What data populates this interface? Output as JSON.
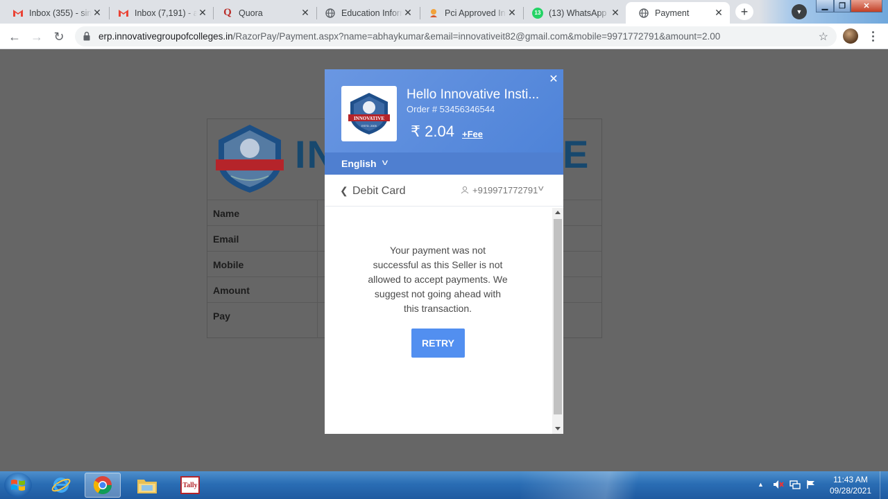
{
  "tabs": [
    {
      "label": "Inbox (355) - sin",
      "icon": "gmail-icon"
    },
    {
      "label": "Inbox (7,191) - a",
      "icon": "gmail-icon"
    },
    {
      "label": "Quora",
      "icon": "quora-icon"
    },
    {
      "label": "Education Inform",
      "icon": "globe-icon"
    },
    {
      "label": "Pci Approved In",
      "icon": "pci-icon"
    },
    {
      "label": "(13) WhatsApp",
      "icon": "whatsapp-icon",
      "badge": "13"
    },
    {
      "label": "Payment",
      "icon": "globe-icon",
      "active": true
    }
  ],
  "address": {
    "host": "erp.innovativegroupofcolleges.in",
    "path": "/RazorPay/Payment.aspx?name=abhaykumar&email=innovativeit82@gmail.com&mobile=9971772791&amount=2.00"
  },
  "page": {
    "brand_text": "IN",
    "brand_text_right": "E",
    "rows": [
      {
        "label": "Name"
      },
      {
        "label": "Email"
      },
      {
        "label": "Mobile"
      },
      {
        "label": "Amount"
      },
      {
        "label": "Pay"
      }
    ]
  },
  "modal": {
    "merchant": "Hello Innovative Insti...",
    "order": "Order # 53456346544",
    "amount": "₹ 2.04",
    "fee": "+Fee",
    "language": "English",
    "method": "Debit Card",
    "phone": "+919971772791",
    "message": "Your payment was not successful as this Seller is not allowed to accept payments. We suggest not going ahead with this transaction.",
    "retry": "RETRY",
    "logo_text": "INNOVATIVE",
    "logo_est": "ESTD. 2005"
  },
  "taskbar": {
    "time": "11:43 AM",
    "date": "09/28/2021",
    "apps": [
      "chrome-icon",
      "internet-explorer-icon",
      "file-explorer-icon",
      "tally-icon"
    ],
    "tally_label": "Tally"
  },
  "colors": {
    "razorpay_header": "#5b8de0",
    "retry_button": "#528ff0",
    "overlay": "#666666"
  }
}
